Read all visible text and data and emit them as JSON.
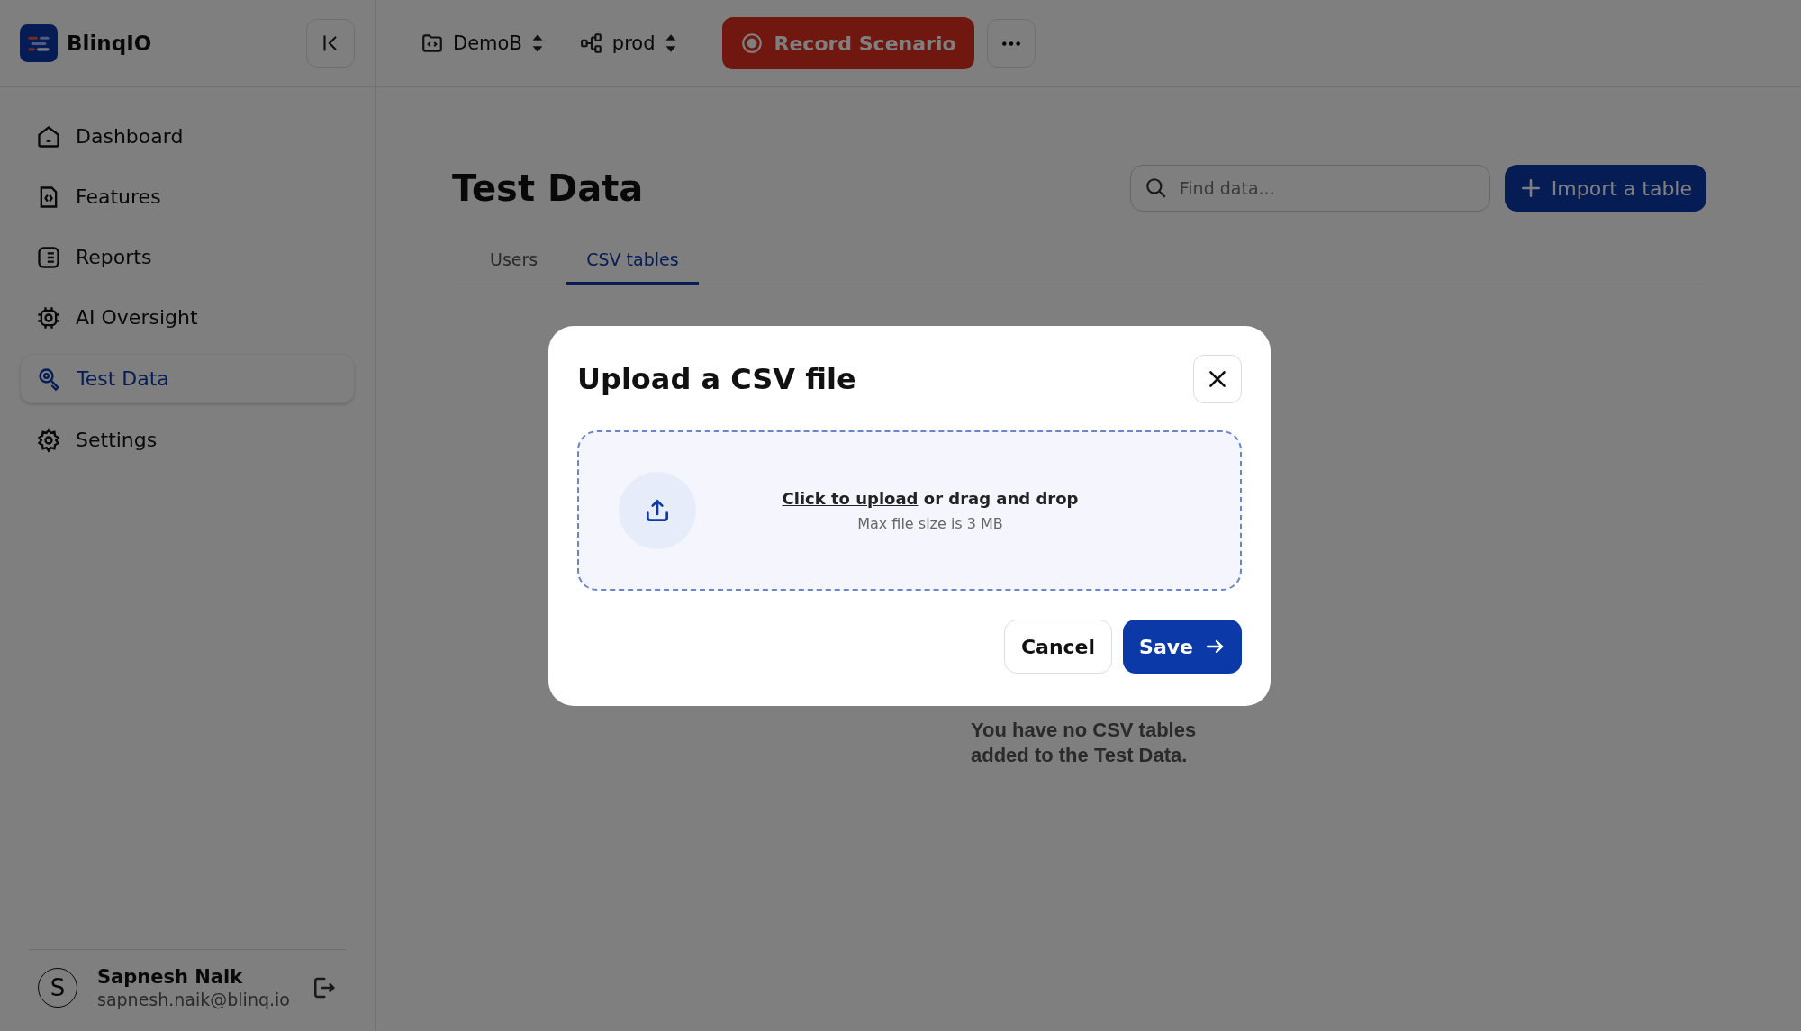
{
  "brand": {
    "name": "BlinqIO"
  },
  "topbar": {
    "project": "DemoB",
    "environment": "prod",
    "record_button": "Record Scenario"
  },
  "sidebar": {
    "items": [
      {
        "label": "Dashboard",
        "selected": false
      },
      {
        "label": "Features",
        "selected": false
      },
      {
        "label": "Reports",
        "selected": false
      },
      {
        "label": "AI Oversight",
        "selected": false
      },
      {
        "label": "Test Data",
        "selected": true
      },
      {
        "label": "Settings",
        "selected": false
      }
    ],
    "user": {
      "initial": "S",
      "name": "Sapnesh Naik",
      "email": "sapnesh.naik@blinq.io"
    }
  },
  "page": {
    "title": "Test Data",
    "search": {
      "placeholder": "Find data..."
    },
    "import_button": "Import a table",
    "tabs": [
      {
        "label": "Users",
        "selected": false
      },
      {
        "label": "CSV tables",
        "selected": true
      }
    ],
    "empty_message": "You have no CSV tables added to the Test Data."
  },
  "dialog": {
    "title": "Upload a CSV file",
    "upload_link": "Click to upload",
    "upload_text": "or drag and drop",
    "hint": "Max file size is 3 MB",
    "cancel": "Cancel",
    "save": "Save"
  }
}
